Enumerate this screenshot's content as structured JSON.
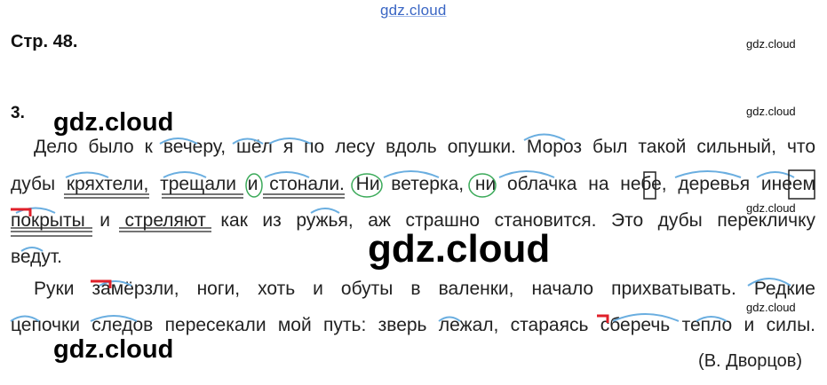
{
  "watermarks": {
    "top": "gdz.cloud",
    "small": "gdz.cloud",
    "big": "gdz.cloud",
    "huge": "gdz.cloud"
  },
  "page": {
    "heading": "Стр. 48.",
    "exercise_number": "3."
  },
  "text": {
    "lines": [
      "Дело было к вечеру, шёл я по лесу вдоль опушки. Мороз был такой сильный, что",
      "дубы кряхтели, трещали и стонали. Ни ветерка, ни облачка на небе, деревья инеем",
      "покрыты и стреляют как из ружья, аж страшно становится. Это дубы перекличку",
      "ведут.",
      "Руки замёрзли, ноги, хоть и обуты в валенки, начало прихватывать. Редкие",
      "цепочки следов пересекали мой путь: зверь лежал, стараясь сберечь тепло и силы."
    ],
    "author": "(В. Дворцов)"
  },
  "colors": {
    "arc": "#6aaee0",
    "circle": "#3caa5a",
    "bracket": "#e0202a",
    "watermark_top": "#3a66c4"
  }
}
